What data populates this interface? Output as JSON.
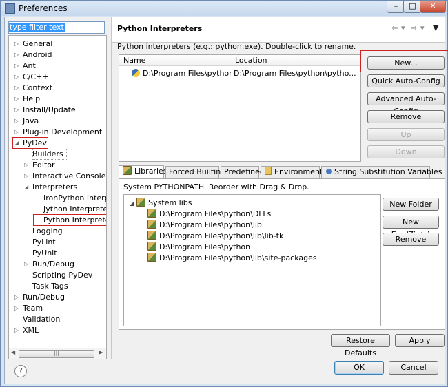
{
  "window": {
    "title": "Preferences"
  },
  "filter": {
    "value": "type filter text"
  },
  "tree": [
    {
      "label": "General",
      "level": 0,
      "state": "collapsed"
    },
    {
      "label": "Android",
      "level": 0,
      "state": "collapsed"
    },
    {
      "label": "Ant",
      "level": 0,
      "state": "collapsed"
    },
    {
      "label": "C/C++",
      "level": 0,
      "state": "collapsed"
    },
    {
      "label": "Context",
      "level": 0,
      "state": "collapsed"
    },
    {
      "label": "Help",
      "level": 0,
      "state": "collapsed"
    },
    {
      "label": "Install/Update",
      "level": 0,
      "state": "collapsed"
    },
    {
      "label": "Java",
      "level": 0,
      "state": "collapsed"
    },
    {
      "label": "Plug-in Development",
      "level": 0,
      "state": "collapsed"
    },
    {
      "label": "PyDev",
      "level": 0,
      "state": "expanded"
    },
    {
      "label": "Builders",
      "level": 1,
      "state": "leaf"
    },
    {
      "label": "Editor",
      "level": 1,
      "state": "collapsed"
    },
    {
      "label": "Interactive Console",
      "level": 1,
      "state": "collapsed"
    },
    {
      "label": "Interpreters",
      "level": 1,
      "state": "expanded"
    },
    {
      "label": "IronPython Interp",
      "level": 2,
      "state": "leaf"
    },
    {
      "label": "Jython Interpreter",
      "level": 2,
      "state": "leaf"
    },
    {
      "label": "Python Interpreter",
      "level": 2,
      "state": "leaf"
    },
    {
      "label": "Logging",
      "level": 1,
      "state": "leaf"
    },
    {
      "label": "PyLint",
      "level": 1,
      "state": "leaf"
    },
    {
      "label": "PyUnit",
      "level": 1,
      "state": "leaf"
    },
    {
      "label": "Run/Debug",
      "level": 1,
      "state": "collapsed"
    },
    {
      "label": "Scripting PyDev",
      "level": 1,
      "state": "leaf"
    },
    {
      "label": "Task Tags",
      "level": 1,
      "state": "leaf"
    },
    {
      "label": "Run/Debug",
      "level": 0,
      "state": "collapsed"
    },
    {
      "label": "Team",
      "level": 0,
      "state": "collapsed"
    },
    {
      "label": "Validation",
      "level": 0,
      "state": "leaf"
    },
    {
      "label": "XML",
      "level": 0,
      "state": "collapsed"
    }
  ],
  "page": {
    "title": "Python Interpreters",
    "description": "Python interpreters (e.g.: python.exe).   Double-click to rename."
  },
  "interpreters_table": {
    "headers": [
      "Name",
      "Location"
    ],
    "rows": [
      {
        "name": "D:\\Program Files\\python\\p",
        "location": "D:\\Program Files\\python\\pytho..."
      }
    ]
  },
  "interpreter_buttons": {
    "new": "New...",
    "quick": "Quick Auto-Config",
    "advanced": "Advanced Auto-Config",
    "remove": "Remove",
    "up": "Up",
    "down": "Down"
  },
  "tabs": [
    "Libraries",
    "Forced Builtins",
    "Predefined",
    "Environment",
    "String Substitution Variables"
  ],
  "libraries": {
    "description": "System PYTHONPATH.   Reorder with Drag & Drop.",
    "root": "System libs",
    "items": [
      "D:\\Program Files\\python\\DLLs",
      "D:\\Program Files\\python\\lib",
      "D:\\Program Files\\python\\lib\\lib-tk",
      "D:\\Program Files\\python",
      "D:\\Program Files\\python\\lib\\site-packages"
    ],
    "buttons": {
      "new_folder": "New Folder",
      "new_egg": "New Egg/Zip(s)",
      "remove": "Remove"
    }
  },
  "footer": {
    "restore": "Restore Defaults",
    "apply": "Apply",
    "ok": "OK",
    "cancel": "Cancel",
    "help": "?"
  }
}
